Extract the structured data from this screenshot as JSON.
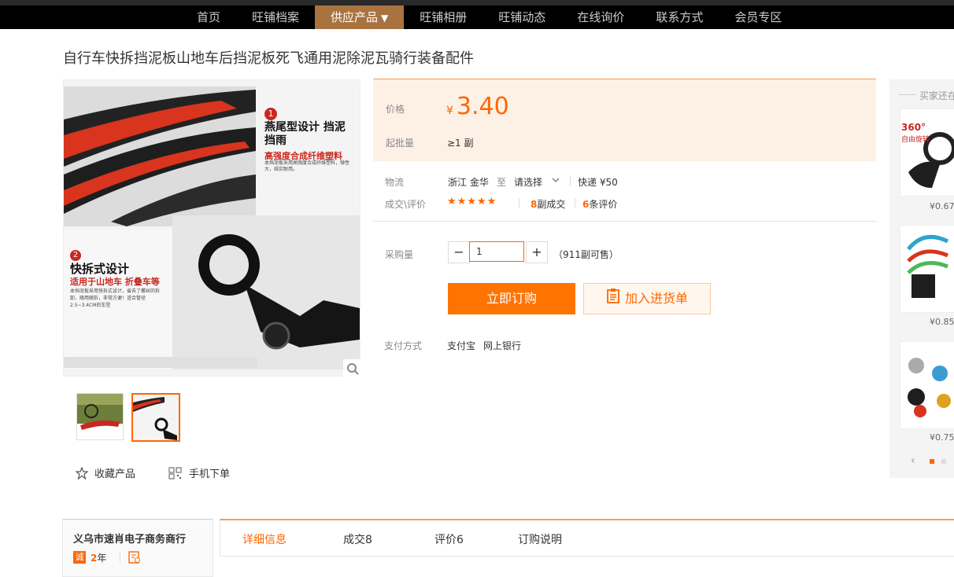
{
  "nav": {
    "items": [
      "首页",
      "旺铺档案",
      "供应产品",
      "旺铺相册",
      "旺铺动态",
      "在线询价",
      "联系方式",
      "会员专区"
    ],
    "active_caret": "▼"
  },
  "product": {
    "title": "自行车快拆挡泥板山地车后挡泥板死飞通用泥除泥瓦骑行装备配件",
    "image_text": {
      "step1_num": "1",
      "step1_title": "燕尾型设计 挡泥挡雨",
      "step1_sub": "高强度合成纤维塑料",
      "step1_desc": "本挡泥板采用高强度合成纤维塑料，弹性大，结实耐用。",
      "step2_num": "2",
      "step2_title": "快拆式设计",
      "step2_sub": "适用于山地车 折叠车等",
      "step2_desc": "本挡泥板采用快拆式设计，省去了螺丝的拆卸，随用随拆，非常方便！适合管径2.5~3.4CM的车型"
    }
  },
  "actions": {
    "favorite": "收藏产品",
    "mobile": "手机下单"
  },
  "price": {
    "label": "价格",
    "currency": "¥",
    "amount": "3.40",
    "moq_label": "起批量",
    "moq_value": "≥1 副"
  },
  "logistics": {
    "label": "物流",
    "origin": "浙江 金华",
    "to": "至",
    "dest": "请选择",
    "express": "快递 ¥50"
  },
  "deal": {
    "label": "成交\\评价",
    "stars": "★★★★★",
    "deals_count": "8",
    "deals_text": "副成交",
    "reviews_count": "6",
    "reviews_text": "条评价"
  },
  "purchase": {
    "label": "采购量",
    "qty": "1",
    "stock": "（911副可售）",
    "buy": "立即订购",
    "cart": "加入进货单"
  },
  "payment": {
    "label": "支付方式",
    "methods": [
      "支付宝",
      "网上银行"
    ]
  },
  "sidebar": {
    "heading": "买家还在",
    "items": [
      {
        "price": "¥0.67",
        "tag": "360°",
        "tag2": "自由旋转"
      },
      {
        "price": "¥0.85"
      },
      {
        "price": "¥0.75"
      }
    ],
    "prev": "‹"
  },
  "shop": {
    "name": "义乌市速肖电子商务商行",
    "years_num": "2",
    "years_unit": "年",
    "badge": "诚"
  },
  "tabs": [
    "详细信息",
    "成交8",
    "评价6",
    "订购说明"
  ],
  "colors": {
    "accent": "#ff7300",
    "nav_active": "#a9733f",
    "price_bg": "#fdf1e6"
  }
}
